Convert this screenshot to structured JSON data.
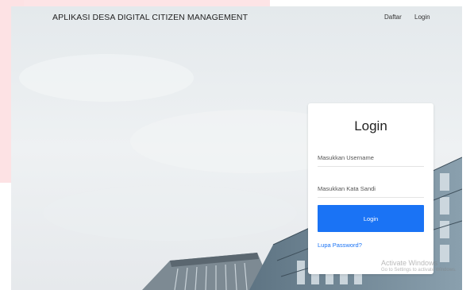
{
  "header": {
    "title": "APLIKASI DESA DIGITAL CITIZEN MANAGEMENT",
    "nav": {
      "register": "Daftar",
      "login": "Login"
    }
  },
  "login_card": {
    "title": "Login",
    "username_placeholder": "Masukkan Username",
    "password_placeholder": "Masukkan Kata Sandi",
    "submit_label": "Login",
    "forgot_password": "Lupa Password?"
  },
  "watermark": {
    "title": "Activate Windows",
    "subtitle": "Go to Settings to activate Windows."
  },
  "colors": {
    "primary": "#1a73f5",
    "accent_pink": "#fde2e4"
  }
}
